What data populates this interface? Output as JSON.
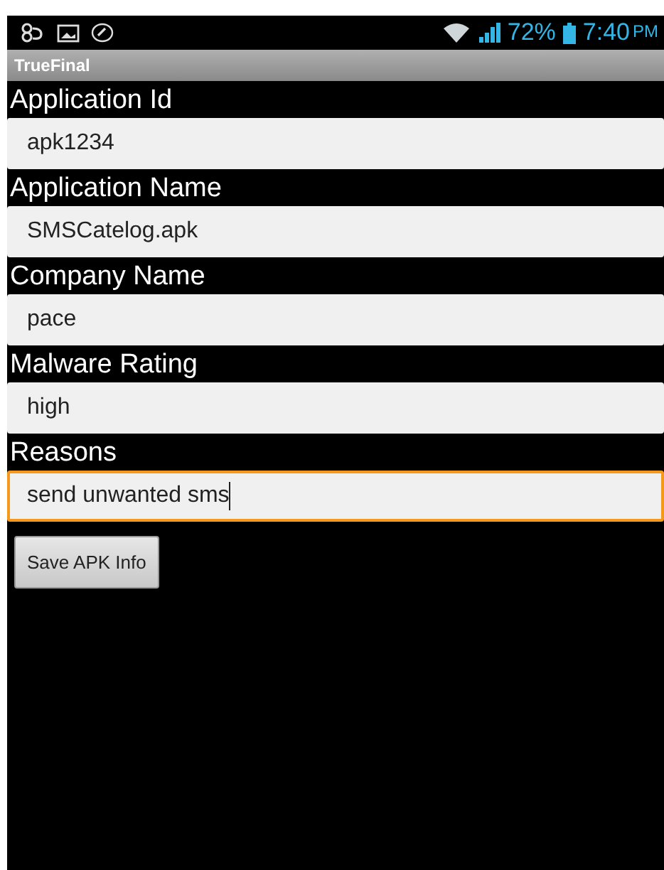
{
  "status_bar": {
    "battery": "72%",
    "time": "7:40",
    "meridiem": "PM"
  },
  "title_bar": {
    "title": "TrueFinal"
  },
  "fields": [
    {
      "label": "Application Id",
      "value": "apk1234",
      "focused": false
    },
    {
      "label": "Application Name",
      "value": "SMSCatelog.apk",
      "focused": false
    },
    {
      "label": "Company Name",
      "value": "pace",
      "focused": false
    },
    {
      "label": "Malware Rating",
      "value": "high",
      "focused": false
    },
    {
      "label": "Reasons",
      "value": "send unwanted sms",
      "focused": true
    }
  ],
  "button": {
    "label": "Save APK Info"
  }
}
